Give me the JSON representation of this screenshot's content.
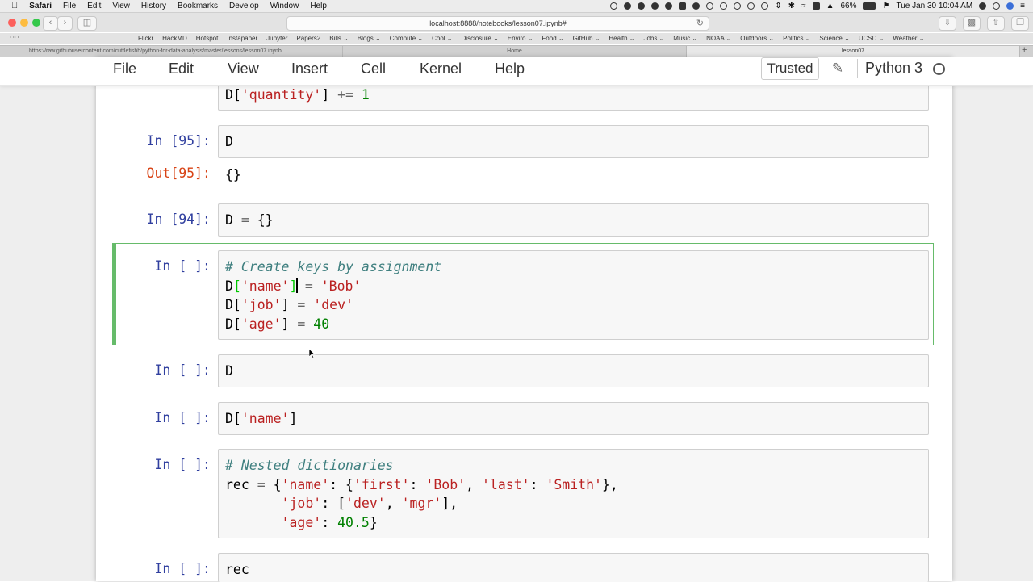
{
  "menubar": {
    "app_name": "Safari",
    "items": [
      "File",
      "Edit",
      "View",
      "History",
      "Bookmarks",
      "Develop",
      "Window",
      "Help"
    ],
    "battery": "66%",
    "datetime": "Tue Jan 30  10:04 AM"
  },
  "toolbar": {
    "address": "localhost:8888/notebooks/lesson07.ipynb#"
  },
  "favorites": [
    "Flickr",
    "HackMD",
    "Hotspot",
    "Instapaper",
    "Jupyter",
    "Papers2",
    "Bills ⌄",
    "Blogs ⌄",
    "Compute ⌄",
    "Cool ⌄",
    "Disclosure ⌄",
    "Enviro ⌄",
    "Food ⌄",
    "GitHub ⌄",
    "Health ⌄",
    "Jobs ⌄",
    "Music ⌄",
    "NOAA ⌄",
    "Outdoors ⌄",
    "Politics ⌄",
    "Science ⌄",
    "UCSD ⌄",
    "Weather ⌄"
  ],
  "tabs": [
    {
      "label": "https://raw.githubusercontent.com/cuttlefishh/python-for-data-analysis/master/lessons/lesson07.ipynb"
    },
    {
      "label": "Home"
    },
    {
      "label": "lesson07"
    }
  ],
  "jupyter": {
    "menu": [
      "File",
      "Edit",
      "View",
      "Insert",
      "Cell",
      "Kernel",
      "Help"
    ],
    "trusted_label": "Trusted",
    "kernel_name": "Python 3"
  },
  "cells": [
    {
      "prompt": "",
      "code": "D['quantity'] += 1"
    },
    {
      "prompt": "In [95]:",
      "code": "D",
      "out_prompt": "Out[95]:",
      "output": "{}"
    },
    {
      "prompt": "In [94]:",
      "code": "D = {}"
    },
    {
      "prompt": "In [ ]:",
      "code": "# Create keys by assignment\nD['name'] = 'Bob'\nD['job'] = 'dev'\nD['age'] = 40",
      "selected": true
    },
    {
      "prompt": "In [ ]:",
      "code": "D"
    },
    {
      "prompt": "In [ ]:",
      "code": "D['name']"
    },
    {
      "prompt": "In [ ]:",
      "code": "# Nested dictionaries\nrec = {'name': {'first': 'Bob', 'last': 'Smith'},\n       'job': ['dev', 'mgr'],\n       'age': 40.5}"
    },
    {
      "prompt": "In [ ]:",
      "code": "rec"
    }
  ]
}
